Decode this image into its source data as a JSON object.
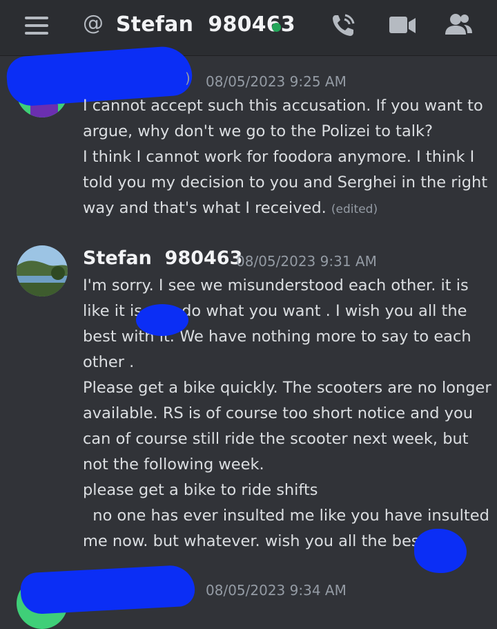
{
  "header": {
    "title": "Stefan  980463",
    "status_color": "#23a559",
    "icons": [
      "hamburger-menu-icon",
      "at-icon",
      "voice-call-icon",
      "video-call-icon",
      "members-icon"
    ]
  },
  "messages": [
    {
      "timestamp": "08/05/2023 9:25 AM",
      "lines": [
        "I cannot accept such this accusation. If you want to",
        "argue, why don't we go to the Polizei to talk?",
        "I think I cannot work for foodora anymore. I think I",
        "told you my decision to you and Serghei in the right",
        "way and that's what I received."
      ],
      "edited": "(edited)"
    },
    {
      "author": "Stefan  980463",
      "timestamp": "08/05/2023 9:31 AM",
      "lines": [
        "I'm sorry. I see we misunderstood each other. it is",
        "like it is        do what you want . I wish you all the",
        "best with it. We have nothing more to say to each",
        "other .",
        "Please get a bike quickly. The scooters are no longer",
        "available. RS is of course too short notice and you",
        "can of course still ride the scooter next week, but",
        "not the following week.",
        "please get a bike to ride shifts",
        "  no one has ever insulted me like you have insulted",
        "me now. but whatever. wish you all the best"
      ]
    },
    {
      "timestamp": "08/05/2023 9:34 AM"
    }
  ]
}
